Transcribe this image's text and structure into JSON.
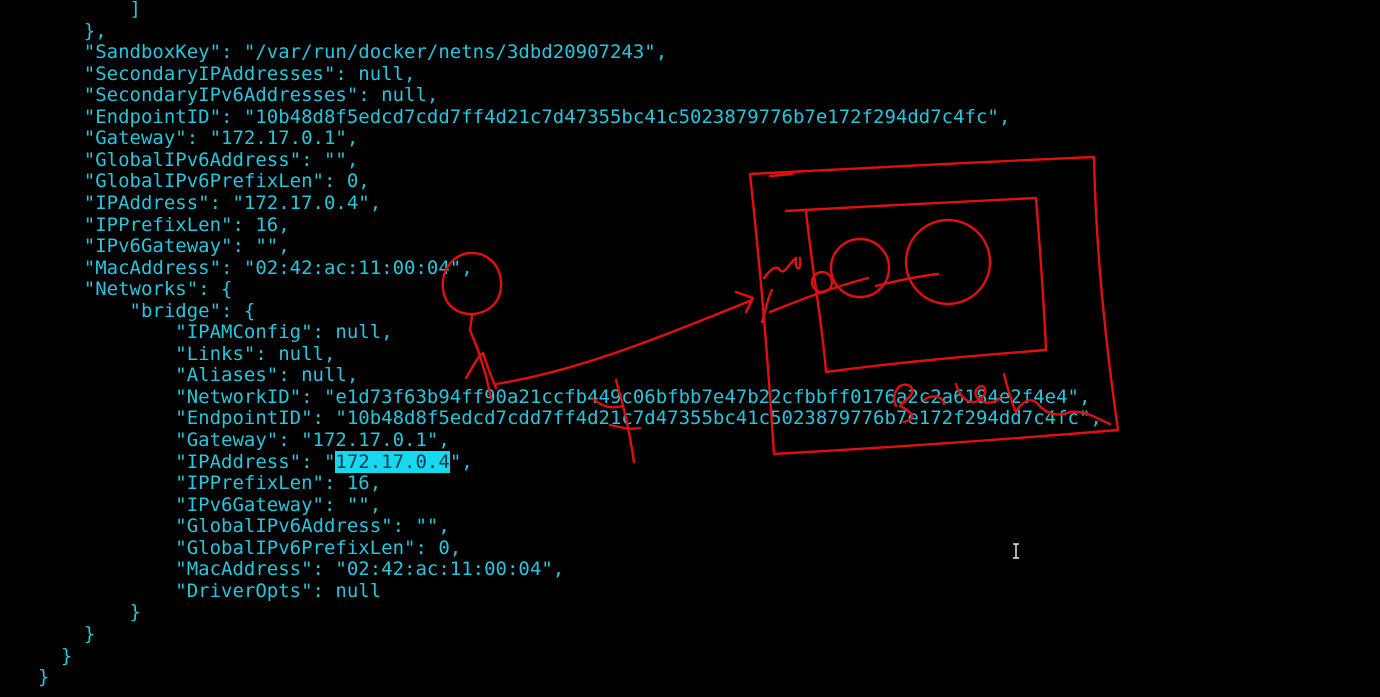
{
  "terminal": {
    "lines": [
      {
        "prefix": "        ]"
      },
      {
        "prefix": "    },"
      },
      {
        "prefix": "    \"SandboxKey\": \"/var/run/docker/netns/3dbd20907243\","
      },
      {
        "prefix": "    \"SecondaryIPAddresses\": null,"
      },
      {
        "prefix": "    \"SecondaryIPv6Addresses\": null,"
      },
      {
        "prefix": "    \"EndpointID\": \"10b48d8f5edcd7cdd7ff4d21c7d47355bc41c5023879776b7e172f294dd7c4fc\","
      },
      {
        "prefix": "    \"Gateway\": \"172.17.0.1\","
      },
      {
        "prefix": "    \"GlobalIPv6Address\": \"\","
      },
      {
        "prefix": "    \"GlobalIPv6PrefixLen\": 0,"
      },
      {
        "prefix": "    \"IPAddress\": \"172.17.0.4\","
      },
      {
        "prefix": "    \"IPPrefixLen\": 16,"
      },
      {
        "prefix": "    \"IPv6Gateway\": \"\","
      },
      {
        "prefix": "    \"MacAddress\": \"02:42:ac:11:00:04\","
      },
      {
        "prefix": "    \"Networks\": {"
      },
      {
        "prefix": "        \"bridge\": {"
      },
      {
        "prefix": "            \"IPAMConfig\": null,"
      },
      {
        "prefix": "            \"Links\": null,"
      },
      {
        "prefix": "            \"Aliases\": null,"
      },
      {
        "prefix": "            \"NetworkID\": \"e1d73f63b94ff90a21ccfb449c06bfbb7e47b22cfbbff0176a2c2a6184e2f4e4\","
      },
      {
        "prefix": "            \"EndpointID\": \"10b48d8f5edcd7cdd7ff4d21c7d47355bc41c5023879776b7e172f294dd7c4fc\","
      },
      {
        "prefix": "            \"Gateway\": \"172.17.0.1\","
      },
      {
        "prefix": "            \"IPAddress\": \"",
        "selected": "172.17.0.4",
        "suffix": "\","
      },
      {
        "prefix": "            \"IPPrefixLen\": 16,"
      },
      {
        "prefix": "            \"IPv6Gateway\": \"\","
      },
      {
        "prefix": "            \"GlobalIPv6Address\": \"\","
      },
      {
        "prefix": "            \"GlobalIPv6PrefixLen\": 0,"
      },
      {
        "prefix": "            \"MacAddress\": \"02:42:ac:11:00:04\","
      },
      {
        "prefix": "            \"DriverOpts\": null"
      },
      {
        "prefix": "        }"
      },
      {
        "prefix": "    }"
      },
      {
        "prefix": "  }"
      },
      {
        "prefix": "}"
      }
    ]
  },
  "colors": {
    "background": "#000000",
    "text": "#26c6dc",
    "selection_bg": "#18d8ee",
    "annotation": "#e01010"
  },
  "annotation": {
    "handwritten_labels": [
      "veth",
      "Bridge",
      "eth0"
    ]
  }
}
